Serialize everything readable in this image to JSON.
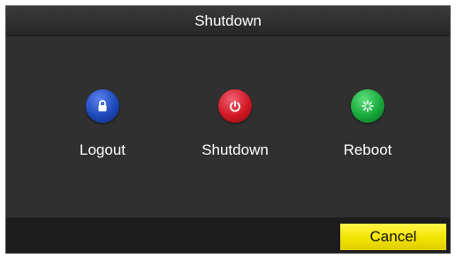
{
  "dialog": {
    "title": "Shutdown"
  },
  "actions": [
    {
      "label": "Logout",
      "icon": "lock-icon",
      "color": "#1d47b8"
    },
    {
      "label": "Shutdown",
      "icon": "power-icon",
      "color": "#d11824"
    },
    {
      "label": "Reboot",
      "icon": "reboot-icon",
      "color": "#17a83a"
    }
  ],
  "footer": {
    "cancel_label": "Cancel"
  },
  "colors": {
    "accent": "#f2e400",
    "panel": "#303030",
    "title_bar": "#2a2a2a"
  }
}
